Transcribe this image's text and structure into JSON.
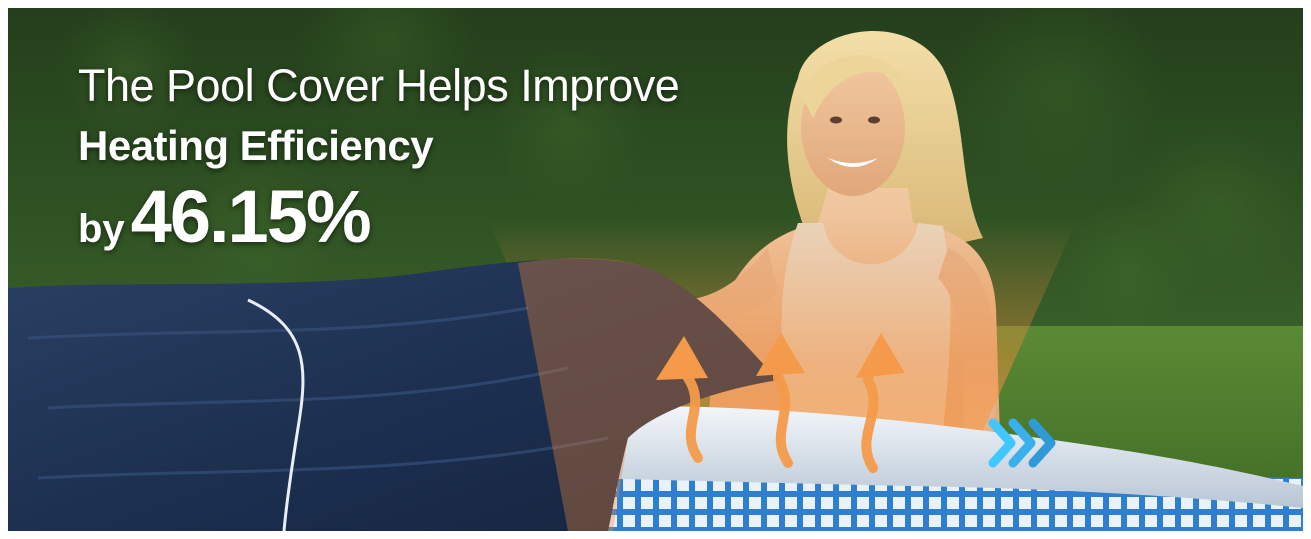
{
  "banner": {
    "headline_line1": "The Pool Cover Helps Improve",
    "headline_line2": "Heating Efficiency",
    "headline_by": "by",
    "headline_percent": "46.15%"
  },
  "colors": {
    "hedge": "#2c4a22",
    "lawn": "#4d7a2e",
    "cover_navy": "#1e3150",
    "heat_orange": "#f49a4a",
    "pool_blue": "#2f7fd0",
    "chevron_cyan": "#3ec8ff"
  },
  "icons": [
    "heat-arrow-icon",
    "chevron-right-icon"
  ]
}
